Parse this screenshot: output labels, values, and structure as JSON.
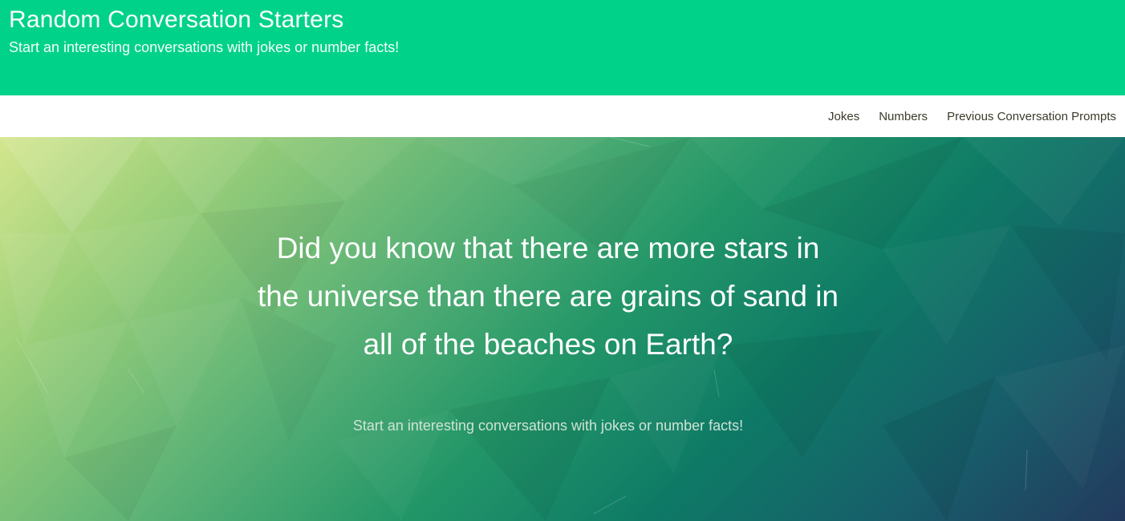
{
  "header": {
    "title": "Random Conversation Starters",
    "subtitle": "Start an interesting conversations with jokes or number facts!",
    "background_color": "#00d28a"
  },
  "nav": {
    "items": [
      {
        "label": "Jokes"
      },
      {
        "label": "Numbers"
      },
      {
        "label": "Previous Conversation Prompts"
      }
    ]
  },
  "hero": {
    "fact": "Did you know that there are more stars in the universe than there are grains of sand in all of the beaches on Earth?",
    "subtitle": "Start an interesting conversations with jokes or number facts!",
    "background": "low-poly green to navy gradient"
  }
}
